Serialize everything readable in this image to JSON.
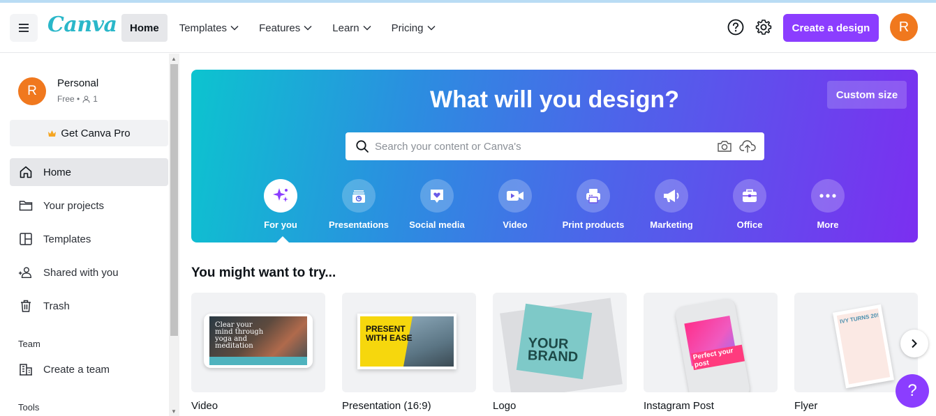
{
  "header": {
    "logo_text": "Canva",
    "nav": [
      {
        "label": "Home"
      },
      {
        "label": "Templates"
      },
      {
        "label": "Features"
      },
      {
        "label": "Learn"
      },
      {
        "label": "Pricing"
      }
    ],
    "create_label": "Create a design",
    "avatar_initial": "R"
  },
  "sidebar": {
    "account": {
      "initial": "R",
      "name": "Personal",
      "plan": "Free •",
      "members": "1"
    },
    "pro_label": "Get Canva Pro",
    "items": [
      {
        "label": "Home",
        "icon": "home-icon"
      },
      {
        "label": "Your projects",
        "icon": "folder-icon"
      },
      {
        "label": "Templates",
        "icon": "templates-icon"
      },
      {
        "label": "Shared with you",
        "icon": "shared-icon"
      },
      {
        "label": "Trash",
        "icon": "trash-icon"
      }
    ],
    "team_heading": "Team",
    "create_team_label": "Create a team",
    "tools_heading": "Tools"
  },
  "hero": {
    "title": "What will you design?",
    "custom_size_label": "Custom size",
    "search_placeholder": "Search your content or Canva's",
    "categories": [
      {
        "label": "For you",
        "icon": "sparkle-icon"
      },
      {
        "label": "Presentations",
        "icon": "presentation-icon"
      },
      {
        "label": "Social media",
        "icon": "heart-chat-icon"
      },
      {
        "label": "Video",
        "icon": "video-icon"
      },
      {
        "label": "Print products",
        "icon": "printer-icon"
      },
      {
        "label": "Marketing",
        "icon": "megaphone-icon"
      },
      {
        "label": "Office",
        "icon": "briefcase-icon"
      },
      {
        "label": "More",
        "icon": "more-icon"
      }
    ]
  },
  "try": {
    "title": "You might want to try...",
    "cards": [
      {
        "label": "Video",
        "thumb_text": "Clear your mind through yoga and meditation"
      },
      {
        "label": "Presentation (16:9)",
        "thumb_text": "PRESENT WITH EASE"
      },
      {
        "label": "Logo",
        "thumb_text": "YOUR BRAND"
      },
      {
        "label": "Instagram Post",
        "thumb_text": "Perfect your post"
      },
      {
        "label": "Flyer",
        "thumb_text": "IVY TURNS 20!"
      }
    ]
  },
  "colors": {
    "brand_purple": "#8b3dff",
    "logo_teal": "#2ab7c9",
    "avatar_orange": "#f0781e"
  },
  "fab_label": "?"
}
